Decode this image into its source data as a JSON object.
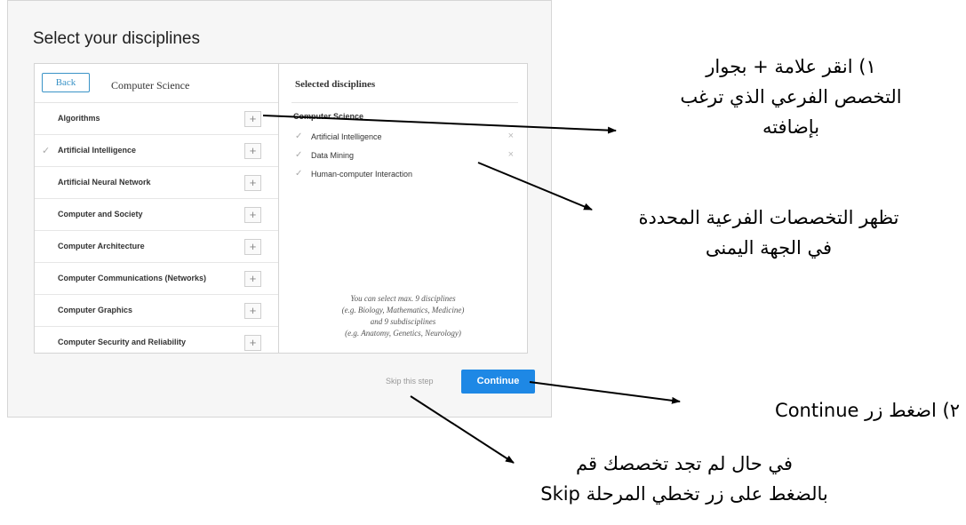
{
  "panel": {
    "title": "Select your disciplines",
    "back_label": "Back",
    "left_heading": "Computer Science",
    "right_heading": "Selected disciplines",
    "disciplines": [
      {
        "label": "Algorithms",
        "checked": false,
        "add_icon": "+"
      },
      {
        "label": "Artificial Intelligence",
        "checked": true,
        "add_icon": "+"
      },
      {
        "label": "Artificial Neural Network",
        "checked": false,
        "add_icon": "+"
      },
      {
        "label": "Computer and Society",
        "checked": false,
        "add_icon": "+"
      },
      {
        "label": "Computer Architecture",
        "checked": false,
        "add_icon": "+"
      },
      {
        "label": "Computer Communications (Networks)",
        "checked": false,
        "add_icon": "+"
      },
      {
        "label": "Computer Graphics",
        "checked": false,
        "add_icon": "+"
      },
      {
        "label": "Computer Security and Reliability",
        "checked": false,
        "add_icon": "+"
      }
    ],
    "check_glyph": "✓",
    "remove_glyph": "×",
    "selected_group": "Computer Science",
    "selected": [
      {
        "label": "Artificial Intelligence",
        "removable": true
      },
      {
        "label": "Data Mining",
        "removable": true
      },
      {
        "label": "Human-computer Interaction",
        "removable": false
      }
    ],
    "hint_lines": [
      "You can select max. 9 disciplines",
      "(e.g. Biology, Mathematics, Medicine)",
      "and 9 subdisciplines",
      "(e.g. Anatomy, Genetics, Neurology)"
    ],
    "skip_label": "Skip this step",
    "continue_label": "Continue",
    "colors": {
      "accent": "#1e88e5",
      "back_border": "#3a93c7"
    }
  },
  "annotations": {
    "note1_lines": [
      "١) انقر علامة + بجوار",
      "التخصص الفرعي الذي ترغب",
      "بإضافته"
    ],
    "note2_lines": [
      "تظهر التخصصات الفرعية المحددة",
      "في الجهة اليمنى"
    ],
    "note3": "٢) اضغط زر Continue",
    "note4_lines": [
      "في حال لم تجد تخصصك قم",
      "بالضغط على زر تخطي المرحلة Skip"
    ]
  }
}
